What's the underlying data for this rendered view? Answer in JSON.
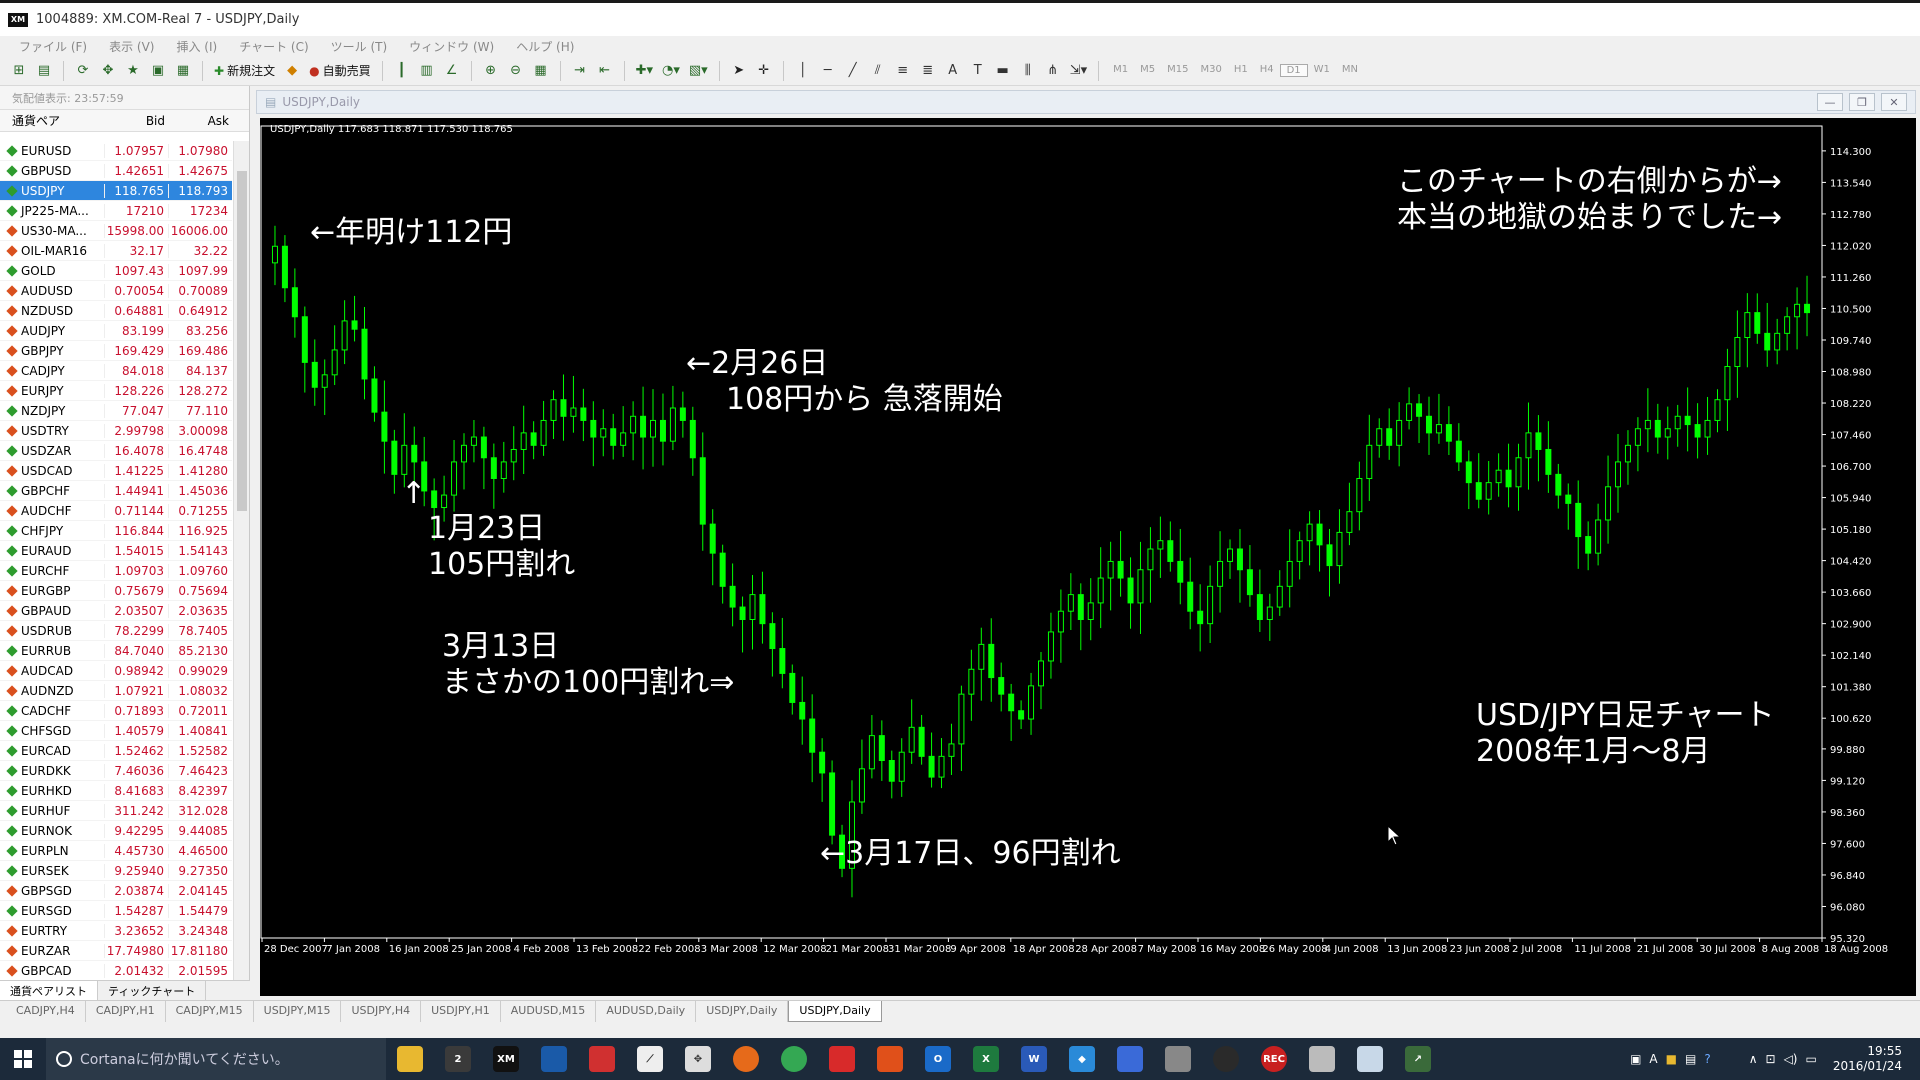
{
  "window": {
    "title": "1004889: XM.COM-Real 7 - USDJPY,Daily",
    "logo": "XM"
  },
  "menu": [
    "ファイル (F)",
    "表示 (V)",
    "挿入 (I)",
    "チャート (C)",
    "ツール (T)",
    "ウィンドウ (W)",
    "ヘルプ (H)"
  ],
  "toolbar": {
    "new_order": "新規注文",
    "auto_trade": "自動売買",
    "timeframes": [
      "M1",
      "M5",
      "M15",
      "M30",
      "H1",
      "H4",
      "D1",
      "W1",
      "MN"
    ]
  },
  "marketwatch": {
    "time_label": "気配値表示: 23:57:59",
    "headers": {
      "symbol": "通貨ペア",
      "bid": "Bid",
      "ask": "Ask"
    },
    "rows": [
      {
        "s": "EURUSD",
        "b": "1.07957",
        "a": "1.07980",
        "d": "up"
      },
      {
        "s": "GBPUSD",
        "b": "1.42651",
        "a": "1.42675",
        "d": "up"
      },
      {
        "s": "USDJPY",
        "b": "118.765",
        "a": "118.793",
        "d": "up",
        "sel": true
      },
      {
        "s": "JP225-MA...",
        "b": "17210",
        "a": "17234",
        "d": "up"
      },
      {
        "s": "US30-MA...",
        "b": "15998.00",
        "a": "16006.00",
        "d": "down"
      },
      {
        "s": "OIL-MAR16",
        "b": "32.17",
        "a": "32.22",
        "d": "down"
      },
      {
        "s": "GOLD",
        "b": "1097.43",
        "a": "1097.99",
        "d": "up"
      },
      {
        "s": "AUDUSD",
        "b": "0.70054",
        "a": "0.70089",
        "d": "down"
      },
      {
        "s": "NZDUSD",
        "b": "0.64881",
        "a": "0.64912",
        "d": "down"
      },
      {
        "s": "AUDJPY",
        "b": "83.199",
        "a": "83.256",
        "d": "down"
      },
      {
        "s": "GBPJPY",
        "b": "169.429",
        "a": "169.486",
        "d": "down"
      },
      {
        "s": "CADJPY",
        "b": "84.018",
        "a": "84.137",
        "d": "down"
      },
      {
        "s": "EURJPY",
        "b": "128.226",
        "a": "128.272",
        "d": "down"
      },
      {
        "s": "NZDJPY",
        "b": "77.047",
        "a": "77.110",
        "d": "up"
      },
      {
        "s": "USDTRY",
        "b": "2.99798",
        "a": "3.00098",
        "d": "down"
      },
      {
        "s": "USDZAR",
        "b": "16.4078",
        "a": "16.4748",
        "d": "up"
      },
      {
        "s": "USDCAD",
        "b": "1.41225",
        "a": "1.41280",
        "d": "down"
      },
      {
        "s": "GBPCHF",
        "b": "1.44941",
        "a": "1.45036",
        "d": "up"
      },
      {
        "s": "AUDCHF",
        "b": "0.71144",
        "a": "0.71255",
        "d": "down"
      },
      {
        "s": "CHFJPY",
        "b": "116.844",
        "a": "116.925",
        "d": "up"
      },
      {
        "s": "EURAUD",
        "b": "1.54015",
        "a": "1.54143",
        "d": "up"
      },
      {
        "s": "EURCHF",
        "b": "1.09703",
        "a": "1.09760",
        "d": "up"
      },
      {
        "s": "EURGBP",
        "b": "0.75679",
        "a": "0.75694",
        "d": "down"
      },
      {
        "s": "GBPAUD",
        "b": "2.03507",
        "a": "2.03635",
        "d": "down"
      },
      {
        "s": "USDRUB",
        "b": "78.2299",
        "a": "78.7405",
        "d": "down"
      },
      {
        "s": "EURRUB",
        "b": "84.7040",
        "a": "85.2130",
        "d": "up"
      },
      {
        "s": "AUDCAD",
        "b": "0.98942",
        "a": "0.99029",
        "d": "down"
      },
      {
        "s": "AUDNZD",
        "b": "1.07921",
        "a": "1.08032",
        "d": "down"
      },
      {
        "s": "CADCHF",
        "b": "0.71893",
        "a": "0.72011",
        "d": "up"
      },
      {
        "s": "CHFSGD",
        "b": "1.40579",
        "a": "1.40841",
        "d": "up"
      },
      {
        "s": "EURCAD",
        "b": "1.52462",
        "a": "1.52582",
        "d": "up"
      },
      {
        "s": "EURDKK",
        "b": "7.46036",
        "a": "7.46423",
        "d": "up"
      },
      {
        "s": "EURHKD",
        "b": "8.41683",
        "a": "8.42397",
        "d": "up"
      },
      {
        "s": "EURHUF",
        "b": "311.242",
        "a": "312.028",
        "d": "up"
      },
      {
        "s": "EURNOK",
        "b": "9.42295",
        "a": "9.44085",
        "d": "up"
      },
      {
        "s": "EURPLN",
        "b": "4.45730",
        "a": "4.46500",
        "d": "up"
      },
      {
        "s": "EURSEK",
        "b": "9.25940",
        "a": "9.27350",
        "d": "up"
      },
      {
        "s": "GBPSGD",
        "b": "2.03874",
        "a": "2.04145",
        "d": "down"
      },
      {
        "s": "EURSGD",
        "b": "1.54287",
        "a": "1.54479",
        "d": "up"
      },
      {
        "s": "EURTRY",
        "b": "3.23652",
        "a": "3.24348",
        "d": "down"
      },
      {
        "s": "EURZAR",
        "b": "17.74980",
        "a": "17.81180",
        "d": "down"
      },
      {
        "s": "GBPCAD",
        "b": "2.01432",
        "a": "2.01595",
        "d": "down"
      }
    ],
    "tabs": [
      "通貨ペアリスト",
      "ティックチャート"
    ]
  },
  "chart_window": {
    "title": "USDJPY,Daily",
    "info": "USDJPY,Daily  117.683 118.871 117.530 118.765"
  },
  "annotations": {
    "new_year": "←年明け112円",
    "feb26_line1": "←2月26日",
    "feb26_line2": "108円から 急落開始",
    "jan23_arrow": "↑",
    "jan23_line1": "1月23日",
    "jan23_line2": "105円割れ",
    "mar13_line1": "3月13日",
    "mar13_line2": "まさかの100円割れ⇒",
    "mar17": "←3月17日、96円割れ",
    "hell_line1": "このチャートの右側からが→",
    "hell_line2": "本当の地獄の始まりでした→",
    "caption_line1": "USD/JPY日足チャート",
    "caption_line2": "2008年1月～8月"
  },
  "chart_data": {
    "type": "candlestick",
    "symbol": "USDJPY",
    "timeframe": "Daily",
    "ylim": [
      95.32,
      114.9
    ],
    "y_ticks": [
      "114.300",
      "113.540",
      "112.780",
      "112.020",
      "111.260",
      "110.500",
      "109.740",
      "108.980",
      "108.220",
      "107.460",
      "106.700",
      "105.940",
      "105.180",
      "104.420",
      "103.660",
      "102.900",
      "102.140",
      "101.380",
      "100.620",
      "99.880",
      "99.120",
      "98.360",
      "97.600",
      "96.840",
      "96.080",
      "95.320"
    ],
    "x_ticks": [
      "28 Dec 2007",
      "7 Jan 2008",
      "16 Jan 2008",
      "25 Jan 2008",
      "4 Feb 2008",
      "13 Feb 2008",
      "22 Feb 2008",
      "3 Mar 2008",
      "12 Mar 2008",
      "21 Mar 2008",
      "31 Mar 2008",
      "9 Apr 2008",
      "18 Apr 2008",
      "28 Apr 2008",
      "7 May 2008",
      "16 May 2008",
      "26 May 2008",
      "4 Jun 2008",
      "13 Jun 2008",
      "23 Jun 2008",
      "2 Jul 2008",
      "11 Jul 2008",
      "21 Jul 2008",
      "30 Jul 2008",
      "8 Aug 2008",
      "18 Aug 2008"
    ],
    "close": [
      112.0,
      111.0,
      110.3,
      109.2,
      108.6,
      108.9,
      109.5,
      110.2,
      110.0,
      108.8,
      108.0,
      107.3,
      106.5,
      107.2,
      106.8,
      106.1,
      105.7,
      106.0,
      106.8,
      107.2,
      107.4,
      106.9,
      106.4,
      106.8,
      107.1,
      107.5,
      107.2,
      107.8,
      108.3,
      107.9,
      108.1,
      107.8,
      107.4,
      107.6,
      107.2,
      107.5,
      107.9,
      107.4,
      107.8,
      107.3,
      108.1,
      107.8,
      106.9,
      105.3,
      104.6,
      103.8,
      103.3,
      103.0,
      103.6,
      102.9,
      102.3,
      101.7,
      101.0,
      100.6,
      99.8,
      99.3,
      97.8,
      97.0,
      98.6,
      99.4,
      100.2,
      99.6,
      99.1,
      99.8,
      100.4,
      99.7,
      99.2,
      99.7,
      100.0,
      101.2,
      101.8,
      102.4,
      101.6,
      101.2,
      100.8,
      100.6,
      101.4,
      102.0,
      102.7,
      103.2,
      103.6,
      103.0,
      103.4,
      104.0,
      104.4,
      104.0,
      103.4,
      104.2,
      104.7,
      104.9,
      104.4,
      103.9,
      103.2,
      102.9,
      103.8,
      104.4,
      104.7,
      104.2,
      103.6,
      103.0,
      103.3,
      103.8,
      104.4,
      104.9,
      105.3,
      104.8,
      104.3,
      105.1,
      105.6,
      106.4,
      107.2,
      107.6,
      107.2,
      107.8,
      108.2,
      107.9,
      107.5,
      107.7,
      107.3,
      106.8,
      106.3,
      105.9,
      106.3,
      106.6,
      106.2,
      106.9,
      107.5,
      107.1,
      106.5,
      106.0,
      105.8,
      105.0,
      104.6,
      105.4,
      106.2,
      106.8,
      107.2,
      107.6,
      107.8,
      107.4,
      107.6,
      107.9,
      107.7,
      107.4,
      107.8,
      108.3,
      109.1,
      109.8,
      110.4,
      109.9,
      109.5,
      109.9,
      110.3,
      110.6,
      110.4
    ]
  },
  "chart_tabs": [
    "CADJPY,H4",
    "CADJPY,H1",
    "CADJPY,M15",
    "USDJPY,M15",
    "USDJPY,H4",
    "USDJPY,H1",
    "AUDUSD,M15",
    "AUDUSD,Daily",
    "USDJPY,Daily",
    "USDJPY,Daily"
  ],
  "taskbar": {
    "search_placeholder": "Cortanaに何か聞いてください。",
    "time": "19:55",
    "date": "2016/01/24"
  },
  "colors": {
    "chart_bg": "#000000",
    "candle": "#00ff00",
    "up_dot": "#2e9c2e",
    "down_dot": "#d9501e",
    "bid_ask_text": "#c8102e"
  }
}
